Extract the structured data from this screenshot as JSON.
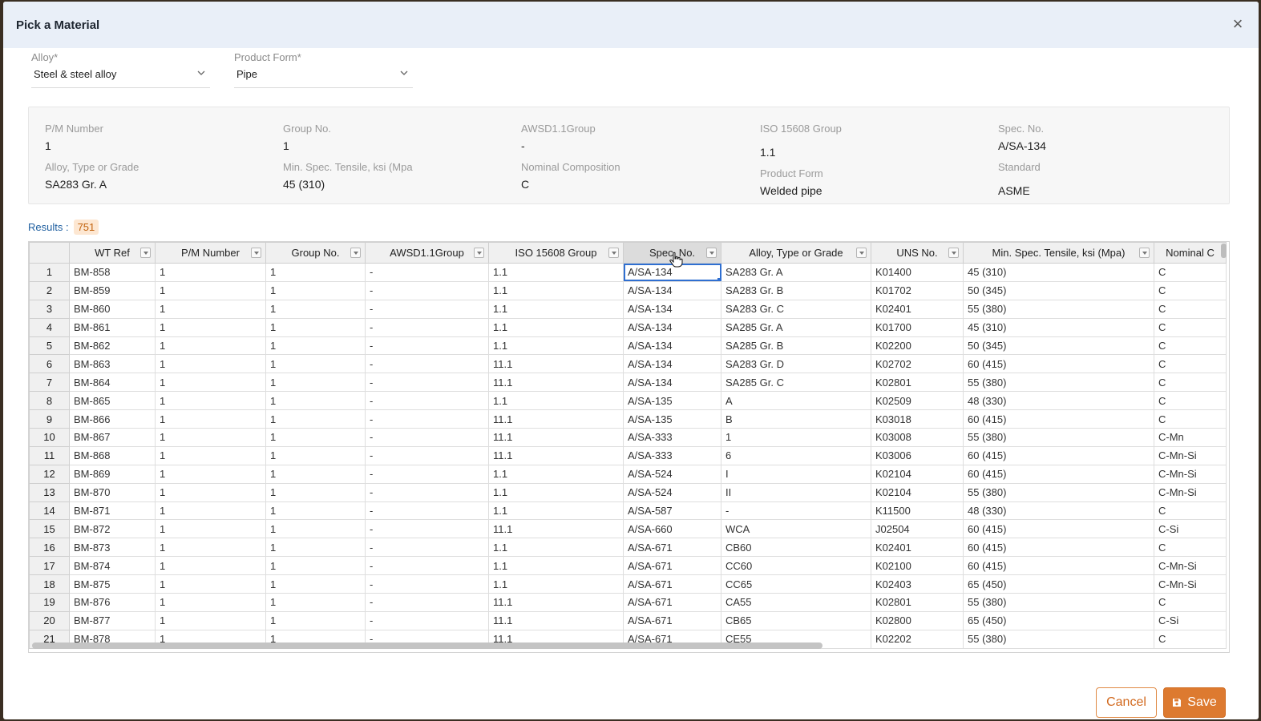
{
  "modal": {
    "title": "Pick a Material"
  },
  "alloy": {
    "label": "Alloy*",
    "value": "Steel & steel alloy"
  },
  "product_form": {
    "label": "Product Form*",
    "value": "Pipe"
  },
  "info": {
    "pm_number": {
      "label": "P/M Number",
      "value": "1"
    },
    "group_no": {
      "label": "Group No.",
      "value": "1"
    },
    "awsd_group": {
      "label": "AWSD1.1Group",
      "value": "-"
    },
    "iso_group": {
      "label": "ISO 15608 Group",
      "value": "1.1"
    },
    "spec_no": {
      "label": "Spec. No.",
      "value": "A/SA-134"
    },
    "alloy_grade": {
      "label": "Alloy, Type or Grade",
      "value": "SA283 Gr. A"
    },
    "tensile": {
      "label": "Min. Spec. Tensile, ksi (Mpa",
      "value": "45 (310)"
    },
    "composition": {
      "label": "Nominal Composition",
      "value": "C"
    },
    "product_form": {
      "label": "Product Form",
      "value": "Welded pipe"
    },
    "standard": {
      "label": "Standard",
      "value": "ASME"
    }
  },
  "results": {
    "label": "Results :",
    "count": "751"
  },
  "table": {
    "columns": [
      "WT Ref",
      "P/M Number",
      "Group No.",
      "AWSD1.1Group",
      "ISO 15608 Group",
      "Spec. No.",
      "Alloy, Type or Grade",
      "UNS No.",
      "Min. Spec. Tensile, ksi (Mpa)",
      "Nominal C"
    ],
    "rows": [
      [
        "1",
        "BM-858",
        "1",
        "1",
        "-",
        "1.1",
        "A/SA-134",
        "SA283 Gr. A",
        "K01400",
        "45 (310)",
        "C"
      ],
      [
        "2",
        "BM-859",
        "1",
        "1",
        "-",
        "1.1",
        "A/SA-134",
        "SA283 Gr. B",
        "K01702",
        "50 (345)",
        "C"
      ],
      [
        "3",
        "BM-860",
        "1",
        "1",
        "-",
        "1.1",
        "A/SA-134",
        "SA283 Gr. C",
        "K02401",
        "55 (380)",
        "C"
      ],
      [
        "4",
        "BM-861",
        "1",
        "1",
        "-",
        "1.1",
        "A/SA-134",
        "SA285 Gr. A",
        "K01700",
        "45 (310)",
        "C"
      ],
      [
        "5",
        "BM-862",
        "1",
        "1",
        "-",
        "1.1",
        "A/SA-134",
        "SA285 Gr. B",
        "K02200",
        "50 (345)",
        "C"
      ],
      [
        "6",
        "BM-863",
        "1",
        "1",
        "-",
        "11.1",
        "A/SA-134",
        "SA283 Gr. D",
        "K02702",
        "60 (415)",
        "C"
      ],
      [
        "7",
        "BM-864",
        "1",
        "1",
        "-",
        "11.1",
        "A/SA-134",
        "SA285 Gr. C",
        "K02801",
        "55 (380)",
        "C"
      ],
      [
        "8",
        "BM-865",
        "1",
        "1",
        "-",
        "1.1",
        "A/SA-135",
        "A",
        "K02509",
        "48 (330)",
        "C"
      ],
      [
        "9",
        "BM-866",
        "1",
        "1",
        "-",
        "11.1",
        "A/SA-135",
        "B",
        "K03018",
        "60 (415)",
        "C"
      ],
      [
        "10",
        "BM-867",
        "1",
        "1",
        "-",
        "11.1",
        "A/SA-333",
        "1",
        "K03008",
        "55 (380)",
        "C-Mn"
      ],
      [
        "11",
        "BM-868",
        "1",
        "1",
        "-",
        "11.1",
        "A/SA-333",
        "6",
        "K03006",
        "60 (415)",
        "C-Mn-Si"
      ],
      [
        "12",
        "BM-869",
        "1",
        "1",
        "-",
        "1.1",
        "A/SA-524",
        "I",
        "K02104",
        "60 (415)",
        "C-Mn-Si"
      ],
      [
        "13",
        "BM-870",
        "1",
        "1",
        "-",
        "1.1",
        "A/SA-524",
        "II",
        "K02104",
        "55 (380)",
        "C-Mn-Si"
      ],
      [
        "14",
        "BM-871",
        "1",
        "1",
        "-",
        "1.1",
        "A/SA-587",
        "-",
        "K11500",
        "48 (330)",
        "C"
      ],
      [
        "15",
        "BM-872",
        "1",
        "1",
        "-",
        "11.1",
        "A/SA-660",
        "WCA",
        "J02504",
        "60 (415)",
        "C-Si"
      ],
      [
        "16",
        "BM-873",
        "1",
        "1",
        "-",
        "1.1",
        "A/SA-671",
        "CB60",
        "K02401",
        "60 (415)",
        "C"
      ],
      [
        "17",
        "BM-874",
        "1",
        "1",
        "-",
        "1.1",
        "A/SA-671",
        "CC60",
        "K02100",
        "60 (415)",
        "C-Mn-Si"
      ],
      [
        "18",
        "BM-875",
        "1",
        "1",
        "-",
        "1.1",
        "A/SA-671",
        "CC65",
        "K02403",
        "65 (450)",
        "C-Mn-Si"
      ],
      [
        "19",
        "BM-876",
        "1",
        "1",
        "-",
        "11.1",
        "A/SA-671",
        "CA55",
        "K02801",
        "55 (380)",
        "C"
      ],
      [
        "20",
        "BM-877",
        "1",
        "1",
        "-",
        "11.1",
        "A/SA-671",
        "CB65",
        "K02800",
        "65 (450)",
        "C-Si"
      ],
      [
        "21",
        "BM-878",
        "1",
        "1",
        "-",
        "11.1",
        "A/SA-671",
        "CE55",
        "K02202",
        "55 (380)",
        "C"
      ]
    ]
  },
  "buttons": {
    "cancel": "Cancel",
    "save": "Save"
  },
  "colors": {
    "accent": "#dd7a30",
    "header_bg": "#e9eff8",
    "selection": "#2f6fd1"
  }
}
